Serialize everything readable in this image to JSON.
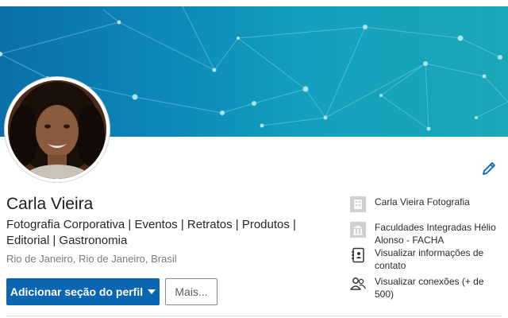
{
  "profile": {
    "name": "Carla Vieira",
    "headline": "Fotografia Corporativa | Eventos | Retratos | Produtos | Editorial | Gastronomia",
    "location": "Rio de Janeiro, Rio de Janeiro, Brasil"
  },
  "actions": {
    "add_section_label": "Adicionar seção do perfil",
    "more_label": "Mais..."
  },
  "sidebar": {
    "items": [
      {
        "label": "Carla Vieira Fotografia",
        "icon": "company-icon"
      },
      {
        "label": "Faculdades Integradas Hélio Alonso - FACHA",
        "icon": "school-icon"
      },
      {
        "label": "Visualizar informações de contato",
        "icon": "contact-book-icon"
      },
      {
        "label": "Visualizar conexões (+ de 500)",
        "icon": "people-icon"
      }
    ]
  },
  "colors": {
    "primary": "#0a66b0",
    "banner_start": "#0a6fa8",
    "banner_end": "#1aa8b8"
  }
}
